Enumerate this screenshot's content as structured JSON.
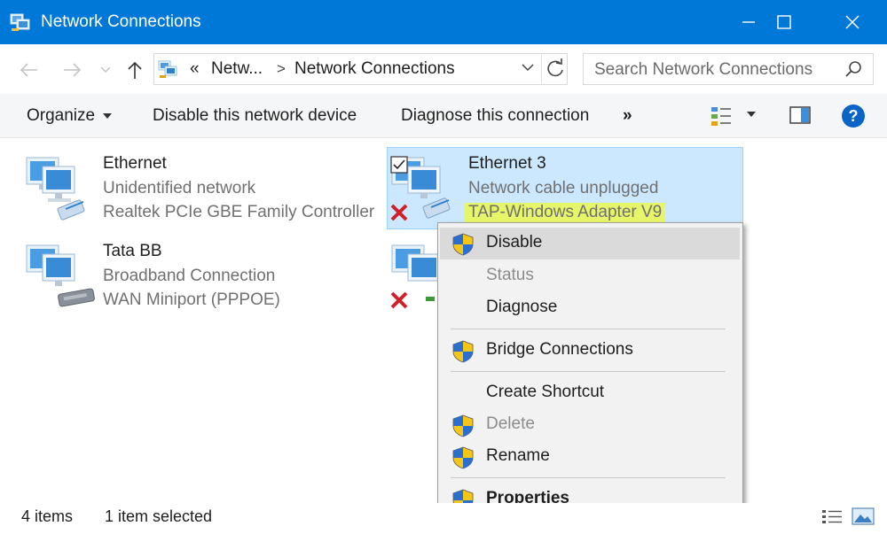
{
  "window": {
    "title": "Network Connections",
    "controls": {
      "minimize": "minimize-icon",
      "maximize": "maximize-icon",
      "close": "close-icon"
    },
    "accent_color": "#0078d7"
  },
  "address_bar": {
    "overflow_marker": "«",
    "crumbs": [
      "Netw...",
      "Network Connections"
    ],
    "separator": ">"
  },
  "search": {
    "placeholder": "Search Network Connections",
    "value": ""
  },
  "command_bar": {
    "organize": "Organize",
    "disable_device": "Disable this network device",
    "diagnose": "Diagnose this connection",
    "more": "»"
  },
  "connections": [
    {
      "name": "Ethernet",
      "status": "Unidentified network",
      "device": "Realtek PCIe GBE Family Controller",
      "selected": false
    },
    {
      "name": "Ethernet 3",
      "status": "Network cable unplugged",
      "device": "TAP-Windows Adapter V9",
      "selected": true
    },
    {
      "name": "Tata BB",
      "status": "Broadband Connection",
      "device": "WAN Miniport (PPPOE)",
      "selected": false
    }
  ],
  "context_menu": {
    "items": [
      {
        "label": "Disable",
        "shield": true,
        "enabled": true,
        "hover": true
      },
      {
        "label": "Status",
        "shield": false,
        "enabled": false
      },
      {
        "label": "Diagnose",
        "shield": false,
        "enabled": true
      },
      {
        "label": "Bridge Connections",
        "shield": true,
        "enabled": true
      },
      {
        "label": "Create Shortcut",
        "shield": false,
        "enabled": true
      },
      {
        "label": "Delete",
        "shield": true,
        "enabled": false
      },
      {
        "label": "Rename",
        "shield": true,
        "enabled": true
      },
      {
        "label": "Properties",
        "shield": true,
        "enabled": true,
        "bold": true
      }
    ]
  },
  "status_bar": {
    "item_count": "4 items",
    "selection": "1 item selected"
  },
  "colors": {
    "selection_bg": "#cce8ff",
    "highlight": "#e7f56a",
    "menu_bg": "#f2f2f2"
  }
}
